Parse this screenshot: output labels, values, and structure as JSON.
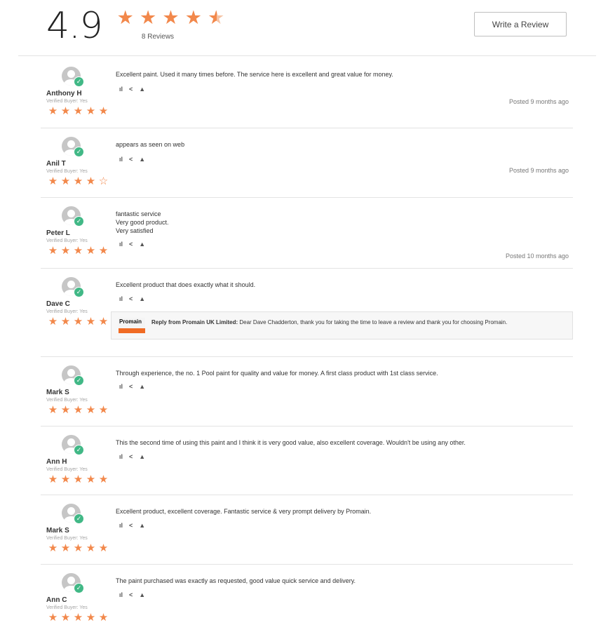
{
  "summary": {
    "average": "4.9",
    "stars": [
      "full",
      "full",
      "full",
      "full",
      "half"
    ],
    "count_text": "8 Reviews",
    "write_review_label": "Write a Review"
  },
  "reviews": [
    {
      "name": "Anthony H",
      "verified": "Verified Buyer: Yes",
      "rating": 5,
      "text": [
        "Excellent paint. Used it many times before. The service here is excellent and great value for money."
      ],
      "posted": "Posted 9 months ago"
    },
    {
      "name": "Anil T",
      "verified": "Verified Buyer: Yes",
      "rating": 4,
      "text": [
        "appears as seen on web"
      ],
      "posted": "Posted 9 months ago"
    },
    {
      "name": "Peter L",
      "verified": "Verified Buyer: Yes",
      "rating": 5,
      "text": [
        "fantastic service",
        "Very good product.",
        "Very satisfied"
      ],
      "posted": "Posted 10 months ago"
    },
    {
      "name": "Dave C",
      "verified": "Verified Buyer: Yes",
      "rating": 5,
      "text": [
        "Excellent product that does exactly what it should."
      ],
      "reply": {
        "logo_text": "Promain",
        "author": "Reply from Promain UK Limited:",
        "text": "Dear Dave Chadderton, thank you for taking the time to leave a review and thank you for choosing Promain."
      }
    },
    {
      "name": "Mark S",
      "verified": "Verified Buyer: Yes",
      "rating": 5,
      "text": [
        "Through experience, the no. 1 Pool paint for quality and value for money. A first class product with 1st class service."
      ]
    },
    {
      "name": "Ann H",
      "verified": "Verified Buyer: Yes",
      "rating": 5,
      "text": [
        "This the second time of using this paint and I think it is very good value, also excellent coverage. Wouldn't be using any other."
      ]
    },
    {
      "name": "Mark S",
      "verified": "Verified Buyer: Yes",
      "rating": 5,
      "text": [
        "Excellent product, excellent coverage. Fantastic service & very prompt delivery by Promain."
      ]
    },
    {
      "name": "Ann C",
      "verified": "Verified Buyer: Yes",
      "rating": 5,
      "text": [
        "The paint purchased was exactly as requested, good value quick service and delivery."
      ]
    }
  ],
  "icons": {
    "like": "thumbs-up-icon",
    "share": "share-icon",
    "report": "report-icon"
  },
  "colors": {
    "star": "#f2884b",
    "verified": "#41b886",
    "reply_accent": "#f06b24"
  }
}
